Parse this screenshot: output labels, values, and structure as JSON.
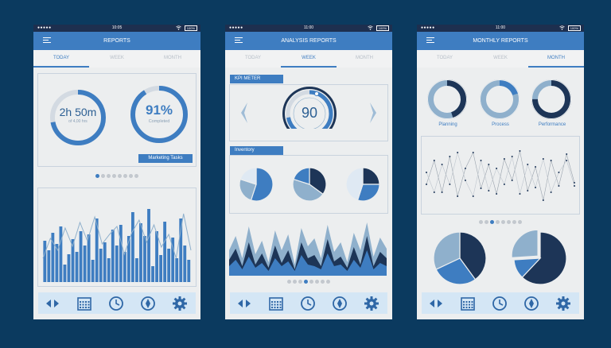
{
  "colors": {
    "background": "#0b3a5f",
    "accent": "#3e7dc1",
    "dark": "#1d3557",
    "light": "#8fb0cc"
  },
  "screens": [
    {
      "status": {
        "dots": "●●●●●",
        "time": "10:05",
        "battery": "100%"
      },
      "title": "REPORTS",
      "tabs": [
        {
          "label": "TODAY",
          "active": true
        },
        {
          "label": "WEEK",
          "active": false
        },
        {
          "label": "MONTH",
          "active": false
        }
      ],
      "stat1": {
        "value": "2h 50m",
        "sub": "of 4,00 hrs",
        "progress": 0.72
      },
      "stat2": {
        "value": "91%",
        "sub": "Completed",
        "progress": 0.91
      },
      "tag": "Marketing Tasks",
      "pager": {
        "count": 8,
        "active": 0
      },
      "bar_values": [
        52,
        40,
        62,
        48,
        70,
        22,
        35,
        54,
        38,
        64,
        46,
        60,
        28,
        80,
        42,
        50,
        30,
        66,
        46,
        72,
        38,
        58,
        88,
        30,
        74,
        58,
        92,
        20,
        64,
        34,
        76,
        42,
        56,
        30,
        80,
        46,
        28
      ],
      "line_values": [
        30,
        55,
        40,
        68,
        45,
        75,
        52,
        82,
        48,
        60,
        70,
        35,
        62,
        78,
        50,
        72,
        44,
        60,
        30,
        86,
        40
      ]
    },
    {
      "status": {
        "dots": "●●●●●",
        "time": "11:00",
        "battery": "100%"
      },
      "title": "ANALYSIS REPORTS",
      "tabs": [
        {
          "label": "TODAY",
          "active": false
        },
        {
          "label": "WEEK",
          "active": true
        },
        {
          "label": "MONTH",
          "active": false
        }
      ],
      "kpi": {
        "label": "KPI METER",
        "value": "90",
        "level": 0.9
      },
      "inventory": {
        "label": "Inventory",
        "pies": [
          [
            0.55,
            0.25,
            0.2
          ],
          [
            0.35,
            0.45,
            0.2
          ],
          [
            0.25,
            0.3,
            0.45
          ]
        ]
      },
      "pager": {
        "count": 8,
        "active": 3
      }
    },
    {
      "status": {
        "dots": "●●●●●",
        "time": "11:00",
        "battery": "100%"
      },
      "title": "MONTHLY REPORTS",
      "tabs": [
        {
          "label": "TODAY",
          "active": false
        },
        {
          "label": "WEEK",
          "active": false
        },
        {
          "label": "MONTH",
          "active": true
        }
      ],
      "donuts": [
        {
          "label": "Planning",
          "value": 0.45
        },
        {
          "label": "Process",
          "value": 0.2
        },
        {
          "label": "Performance",
          "value": 0.75
        }
      ],
      "pager": {
        "count": 8,
        "active": 2
      },
      "big_pies": [
        [
          0.4,
          0.28,
          0.32
        ],
        [
          0.62,
          0.12,
          0.26
        ]
      ]
    }
  ],
  "nav_icons": [
    "arrows-icon",
    "calendar-icon",
    "clock-icon",
    "compass-icon",
    "gear-icon"
  ]
}
